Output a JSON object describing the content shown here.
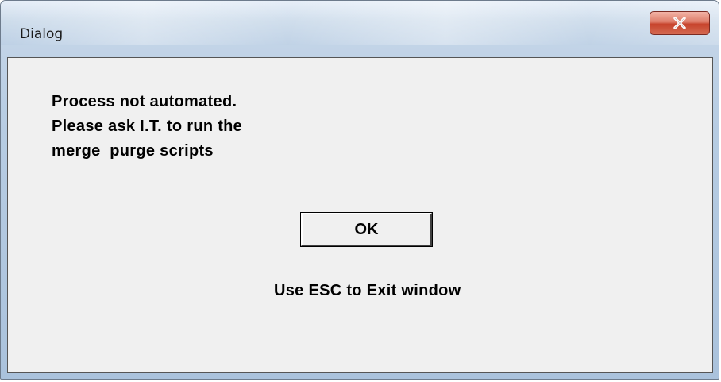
{
  "window": {
    "title": "Dialog",
    "close_icon": "close-icon",
    "accent_color": "#c7432c"
  },
  "dialog": {
    "message_lines": [
      "Process not automated.",
      "Please ask I.T. to run the",
      "merge  purge scripts"
    ],
    "ok_label": "OK",
    "hint": "Use ESC to Exit window"
  }
}
